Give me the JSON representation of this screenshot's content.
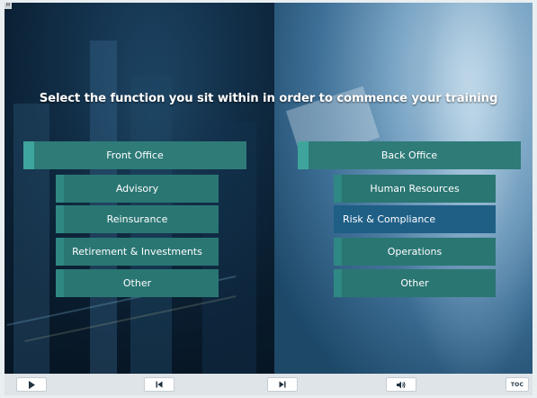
{
  "topmark": "M",
  "headline": "Select the function you sit within in order to commence your training",
  "left_group": {
    "heading": "Front Office",
    "items": [
      "Advisory",
      "Reinsurance",
      "Retirement & Investments",
      "Other"
    ]
  },
  "right_group": {
    "heading": "Back Office",
    "items": [
      "Human Resources",
      "Risk & Compliance",
      "Operations",
      "Other"
    ],
    "selected_item": "Risk & Compliance"
  },
  "controls": {
    "play": "play-icon",
    "prev": "skip-back-icon",
    "next": "skip-forward-icon",
    "volume": "volume-icon",
    "toc_label": "TOC"
  },
  "colors": {
    "button": "#2e7b78",
    "button_accent": "#3fa59c",
    "selected": "#1f5f86",
    "text": "#ffffff"
  }
}
